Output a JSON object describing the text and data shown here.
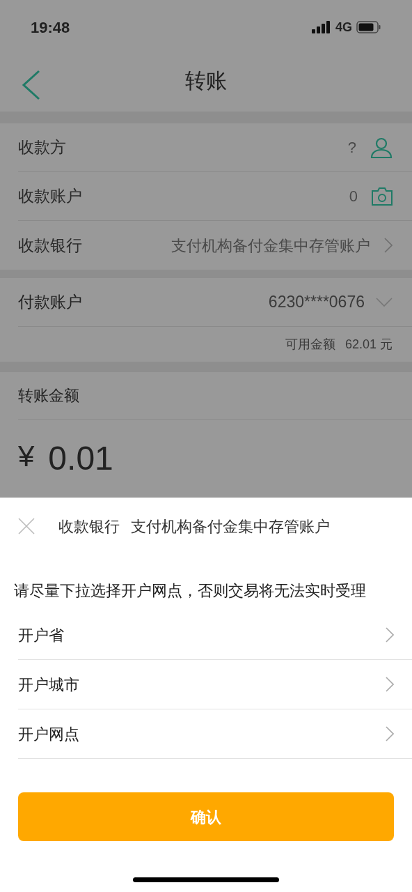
{
  "status_bar": {
    "time": "19:48",
    "network": "4G"
  },
  "nav": {
    "title": "转账"
  },
  "payee_rows": [
    {
      "kind": "contact",
      "label": "收款方",
      "value": "?"
    },
    {
      "kind": "camera",
      "label": "收款账户",
      "value": "0"
    },
    {
      "kind": "chevron",
      "label": "收款银行",
      "value": "支付机构备付金集中存管账户"
    }
  ],
  "payer": {
    "label": "付款账户",
    "value": "6230****0676",
    "available_label": "可用金额",
    "available_amount": "62.01 元"
  },
  "amount": {
    "label": "转账金额",
    "currency": "¥",
    "value": "0.01"
  },
  "sheet": {
    "title_label": "收款银行",
    "title_value": "支付机构备付金集中存管账户",
    "hint": "请尽量下拉选择开户网点，否则交易将无法实时受理",
    "rows": [
      {
        "label": "开户省"
      },
      {
        "label": "开户城市"
      },
      {
        "label": "开户网点"
      }
    ],
    "confirm_button": "确认"
  }
}
